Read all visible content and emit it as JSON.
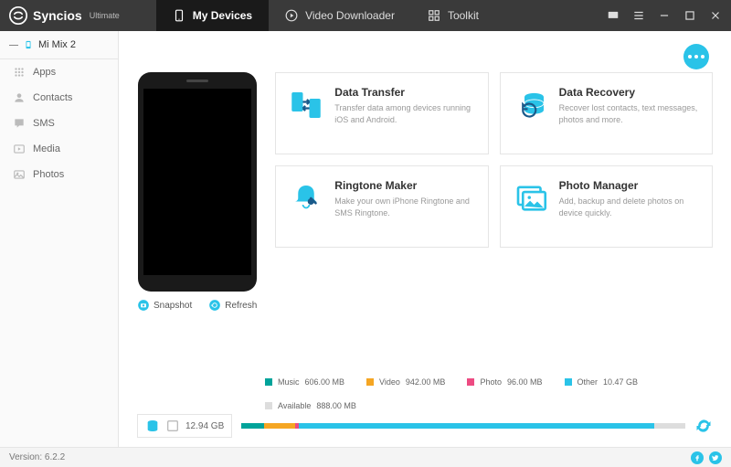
{
  "app": {
    "name": "Syncios",
    "edition": "Ultimate"
  },
  "tabs": [
    {
      "label": "My Devices",
      "active": true
    },
    {
      "label": "Video Downloader",
      "active": false
    },
    {
      "label": "Toolkit",
      "active": false
    }
  ],
  "device": {
    "name": "Mi Mix 2"
  },
  "sidebar": [
    {
      "label": "Apps",
      "icon": "apps-icon"
    },
    {
      "label": "Contacts",
      "icon": "contacts-icon"
    },
    {
      "label": "SMS",
      "icon": "sms-icon"
    },
    {
      "label": "Media",
      "icon": "media-icon"
    },
    {
      "label": "Photos",
      "icon": "photos-icon"
    }
  ],
  "phone_actions": {
    "snapshot": "Snapshot",
    "refresh": "Refresh"
  },
  "cards": [
    {
      "title": "Data Transfer",
      "desc": "Transfer data among devices running iOS and Android."
    },
    {
      "title": "Data Recovery",
      "desc": "Recover lost contacts, text messages, photos and more."
    },
    {
      "title": "Ringtone Maker",
      "desc": "Make your own iPhone Ringtone and SMS Ringtone."
    },
    {
      "title": "Photo Manager",
      "desc": "Add, backup and delete photos on device quickly."
    }
  ],
  "storage": {
    "total": "12.94 GB",
    "items": [
      {
        "label": "Music",
        "value": "606.00 MB",
        "color": "#00a39a",
        "pct": 5
      },
      {
        "label": "Video",
        "value": "942.00 MB",
        "color": "#f5a623",
        "pct": 7
      },
      {
        "label": "Photo",
        "value": "96.00 MB",
        "color": "#ed4b82",
        "pct": 1
      },
      {
        "label": "Other",
        "value": "10.47 GB",
        "color": "#2ac3e8",
        "pct": 80
      },
      {
        "label": "Available",
        "value": "888.00 MB",
        "color": "#dddddd",
        "pct": 7
      }
    ]
  },
  "footer": {
    "version_label": "Version:",
    "version": "6.2.2"
  }
}
